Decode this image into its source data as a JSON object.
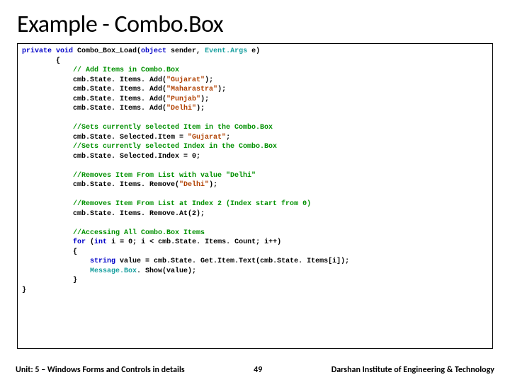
{
  "slide": {
    "title": "Example - Combo.Box"
  },
  "code": {
    "sig1": "private void",
    "sig2": " Combo_Box_Load(",
    "sig3": "object",
    "sig4": " sender, ",
    "sig5": "Event.Args",
    "sig6": " e)",
    "brace_open": "        {",
    "c_add": "            // Add Items in Combo.Box",
    "l_add_pre": "            cmb.State. Items. Add(",
    "s_gujarat": "\"Gujarat\"",
    "s_maharastra": "\"Maharastra\"",
    "s_punjab": "\"Punjab\"",
    "s_delhi": "\"Delhi\"",
    "l_add_post": ");",
    "c_selitem": "            //Sets currently selected Item in the Combo.Box",
    "l_selitem_pre": "            cmb.State. Selected.Item = ",
    "l_selitem_post": "; ",
    "c_selidx": "            //Sets currently selected Index in the Combo.Box",
    "l_selidx": "            cmb.State. Selected.Index = 0;",
    "c_remove": "            //Removes Item From List with value \"Delhi\"",
    "l_remove_pre": "            cmb.State. Items. Remove(",
    "l_remove_post": ");",
    "c_removeat": "            //Removes Item From List at Index 2 (Index start from 0)",
    "l_removeat": "            cmb.State. Items. Remove.At(2);",
    "c_access": "            //Accessing All Combo.Box Items",
    "l_for_pre": "            ",
    "kw_for": "for",
    "l_for_mid1": " (",
    "kw_int": "int",
    "l_for_mid2": " i = 0; i < cmb.State. Items. Count; i++)",
    "l_for_brace": "            {",
    "l_string_pre": "                ",
    "kw_string": "string",
    "l_string_post": " value = cmb.State. Get.Item.Text(cmb.State. Items[i]);",
    "l_msgbox_pre": "                ",
    "cls_msgbox": "Message.Box",
    "l_msgbox_post": ". Show(value);",
    "l_for_close": "            }",
    "brace_close": "}"
  },
  "footer": {
    "unit": "Unit: 5 – Windows Forms and Controls in details",
    "page": "49",
    "institute": "Darshan Institute of Engineering & Technology"
  }
}
